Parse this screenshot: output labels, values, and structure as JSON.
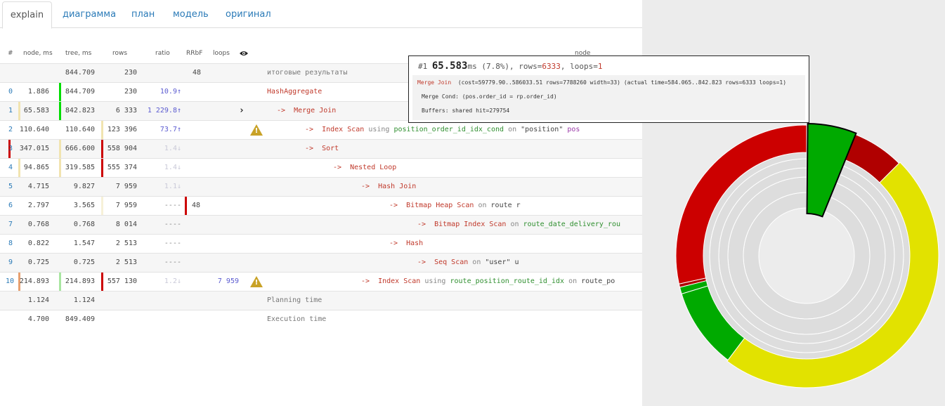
{
  "tabs": [
    {
      "label": "explain"
    },
    {
      "label": "диаграмма"
    },
    {
      "label": "план"
    },
    {
      "label": "модель"
    },
    {
      "label": "оригинал"
    }
  ],
  "headers": {
    "num": "#",
    "node_ms": "node, ms",
    "tree_ms": "tree, ms",
    "rows": "rows",
    "ratio": "ratio",
    "rrbf": "RRbF",
    "loops": "loops",
    "node": "node"
  },
  "summary": {
    "tree": "844.709",
    "rows": "230",
    "rrbf": "48",
    "label": "итоговые результаты"
  },
  "rows": [
    {
      "idx": "0",
      "node": "1.886",
      "tree": "844.709",
      "rows": "230",
      "ratio": "10.9↑",
      "arrow": "",
      "op": "HashAggregate",
      "using": "",
      "index": "",
      "on": "",
      "table": "",
      "alias": ""
    },
    {
      "idx": "1",
      "node": "65.583",
      "tree": "842.823",
      "rows": "6 333",
      "ratio": "1 229.8↑",
      "arrow": "->",
      "op": "Merge Join",
      "using": "",
      "index": "",
      "on": "",
      "table": "",
      "alias": ""
    },
    {
      "idx": "2",
      "node": "110.640",
      "tree": "110.640",
      "rows": "123 396",
      "ratio": "73.7↑",
      "arrow": "->",
      "op": "Index Scan",
      "using": "using",
      "index": "position_order_id_idx_cond",
      "on": "on",
      "table": "\"position\"",
      "alias": "pos"
    },
    {
      "idx": "3",
      "node": "347.015",
      "tree": "666.600",
      "rows": "558 904",
      "ratio": "1.4↓",
      "arrow": "->",
      "op": "Sort",
      "using": "",
      "index": "",
      "on": "",
      "table": "",
      "alias": ""
    },
    {
      "idx": "4",
      "node": "94.865",
      "tree": "319.585",
      "rows": "555 374",
      "ratio": "1.4↓",
      "arrow": "->",
      "op": "Nested Loop",
      "using": "",
      "index": "",
      "on": "",
      "table": "",
      "alias": ""
    },
    {
      "idx": "5",
      "node": "4.715",
      "tree": "9.827",
      "rows": "7 959",
      "ratio": "1.1↓",
      "arrow": "->",
      "op": "Hash Join",
      "using": "",
      "index": "",
      "on": "",
      "table": "",
      "alias": ""
    },
    {
      "idx": "6",
      "node": "2.797",
      "tree": "3.565",
      "rows": "7 959",
      "ratio": "----",
      "rrbf": "48",
      "arrow": "->",
      "op": "Bitmap Heap Scan",
      "using": "",
      "index": "",
      "on": "on",
      "table": "route",
      "alias": "r"
    },
    {
      "idx": "7",
      "node": "0.768",
      "tree": "0.768",
      "rows": "8 014",
      "ratio": "----",
      "arrow": "->",
      "op": "Bitmap Index Scan",
      "using": "",
      "index": "",
      "on": "on",
      "table": "",
      "alias": "",
      "index2": "route_date_delivery_rou"
    },
    {
      "idx": "8",
      "node": "0.822",
      "tree": "1.547",
      "rows": "2 513",
      "ratio": "----",
      "arrow": "->",
      "op": "Hash",
      "using": "",
      "index": "",
      "on": "",
      "table": "",
      "alias": ""
    },
    {
      "idx": "9",
      "node": "0.725",
      "tree": "0.725",
      "rows": "2 513",
      "ratio": "----",
      "arrow": "->",
      "op": "Seq Scan",
      "using": "",
      "index": "",
      "on": "on",
      "table": "\"user\"",
      "alias": "u"
    },
    {
      "idx": "10",
      "node": "214.893",
      "tree": "214.893",
      "rows": "557 130",
      "ratio": "1.2↓",
      "loops": "7 959",
      "arrow": "->",
      "op": "Index Scan",
      "using": "using",
      "index": "route_position_route_id_idx",
      "on": "on",
      "table": "route_po",
      "alias": ""
    }
  ],
  "planning": {
    "node": "1.124",
    "tree": "1.124",
    "label": "Planning time"
  },
  "execution": {
    "node": "4.700",
    "tree": "849.409",
    "label": "Execution time"
  },
  "tooltip": {
    "num": "#1",
    "ms": "65.583",
    "ms_unit": "ms (7.8%), rows=",
    "rows": "6333",
    "loops_label": ", loops=",
    "loops": "1",
    "op": "Merge Join",
    "cost": "(cost=59779.90..586033.51 rows=7788260 width=33) (actual time=584.065..842.823 rows=6333 loops=1)",
    "merge_cond": "Merge Cond: (pos.order_id = rp.order_id)",
    "buffers": "Buffers: shared hit=279754"
  },
  "colors": {
    "red": "#cc0000",
    "dark_red": "#b00000",
    "green": "#00aa00",
    "yellow": "#e2e200",
    "grey_ring": "#dddddd"
  }
}
